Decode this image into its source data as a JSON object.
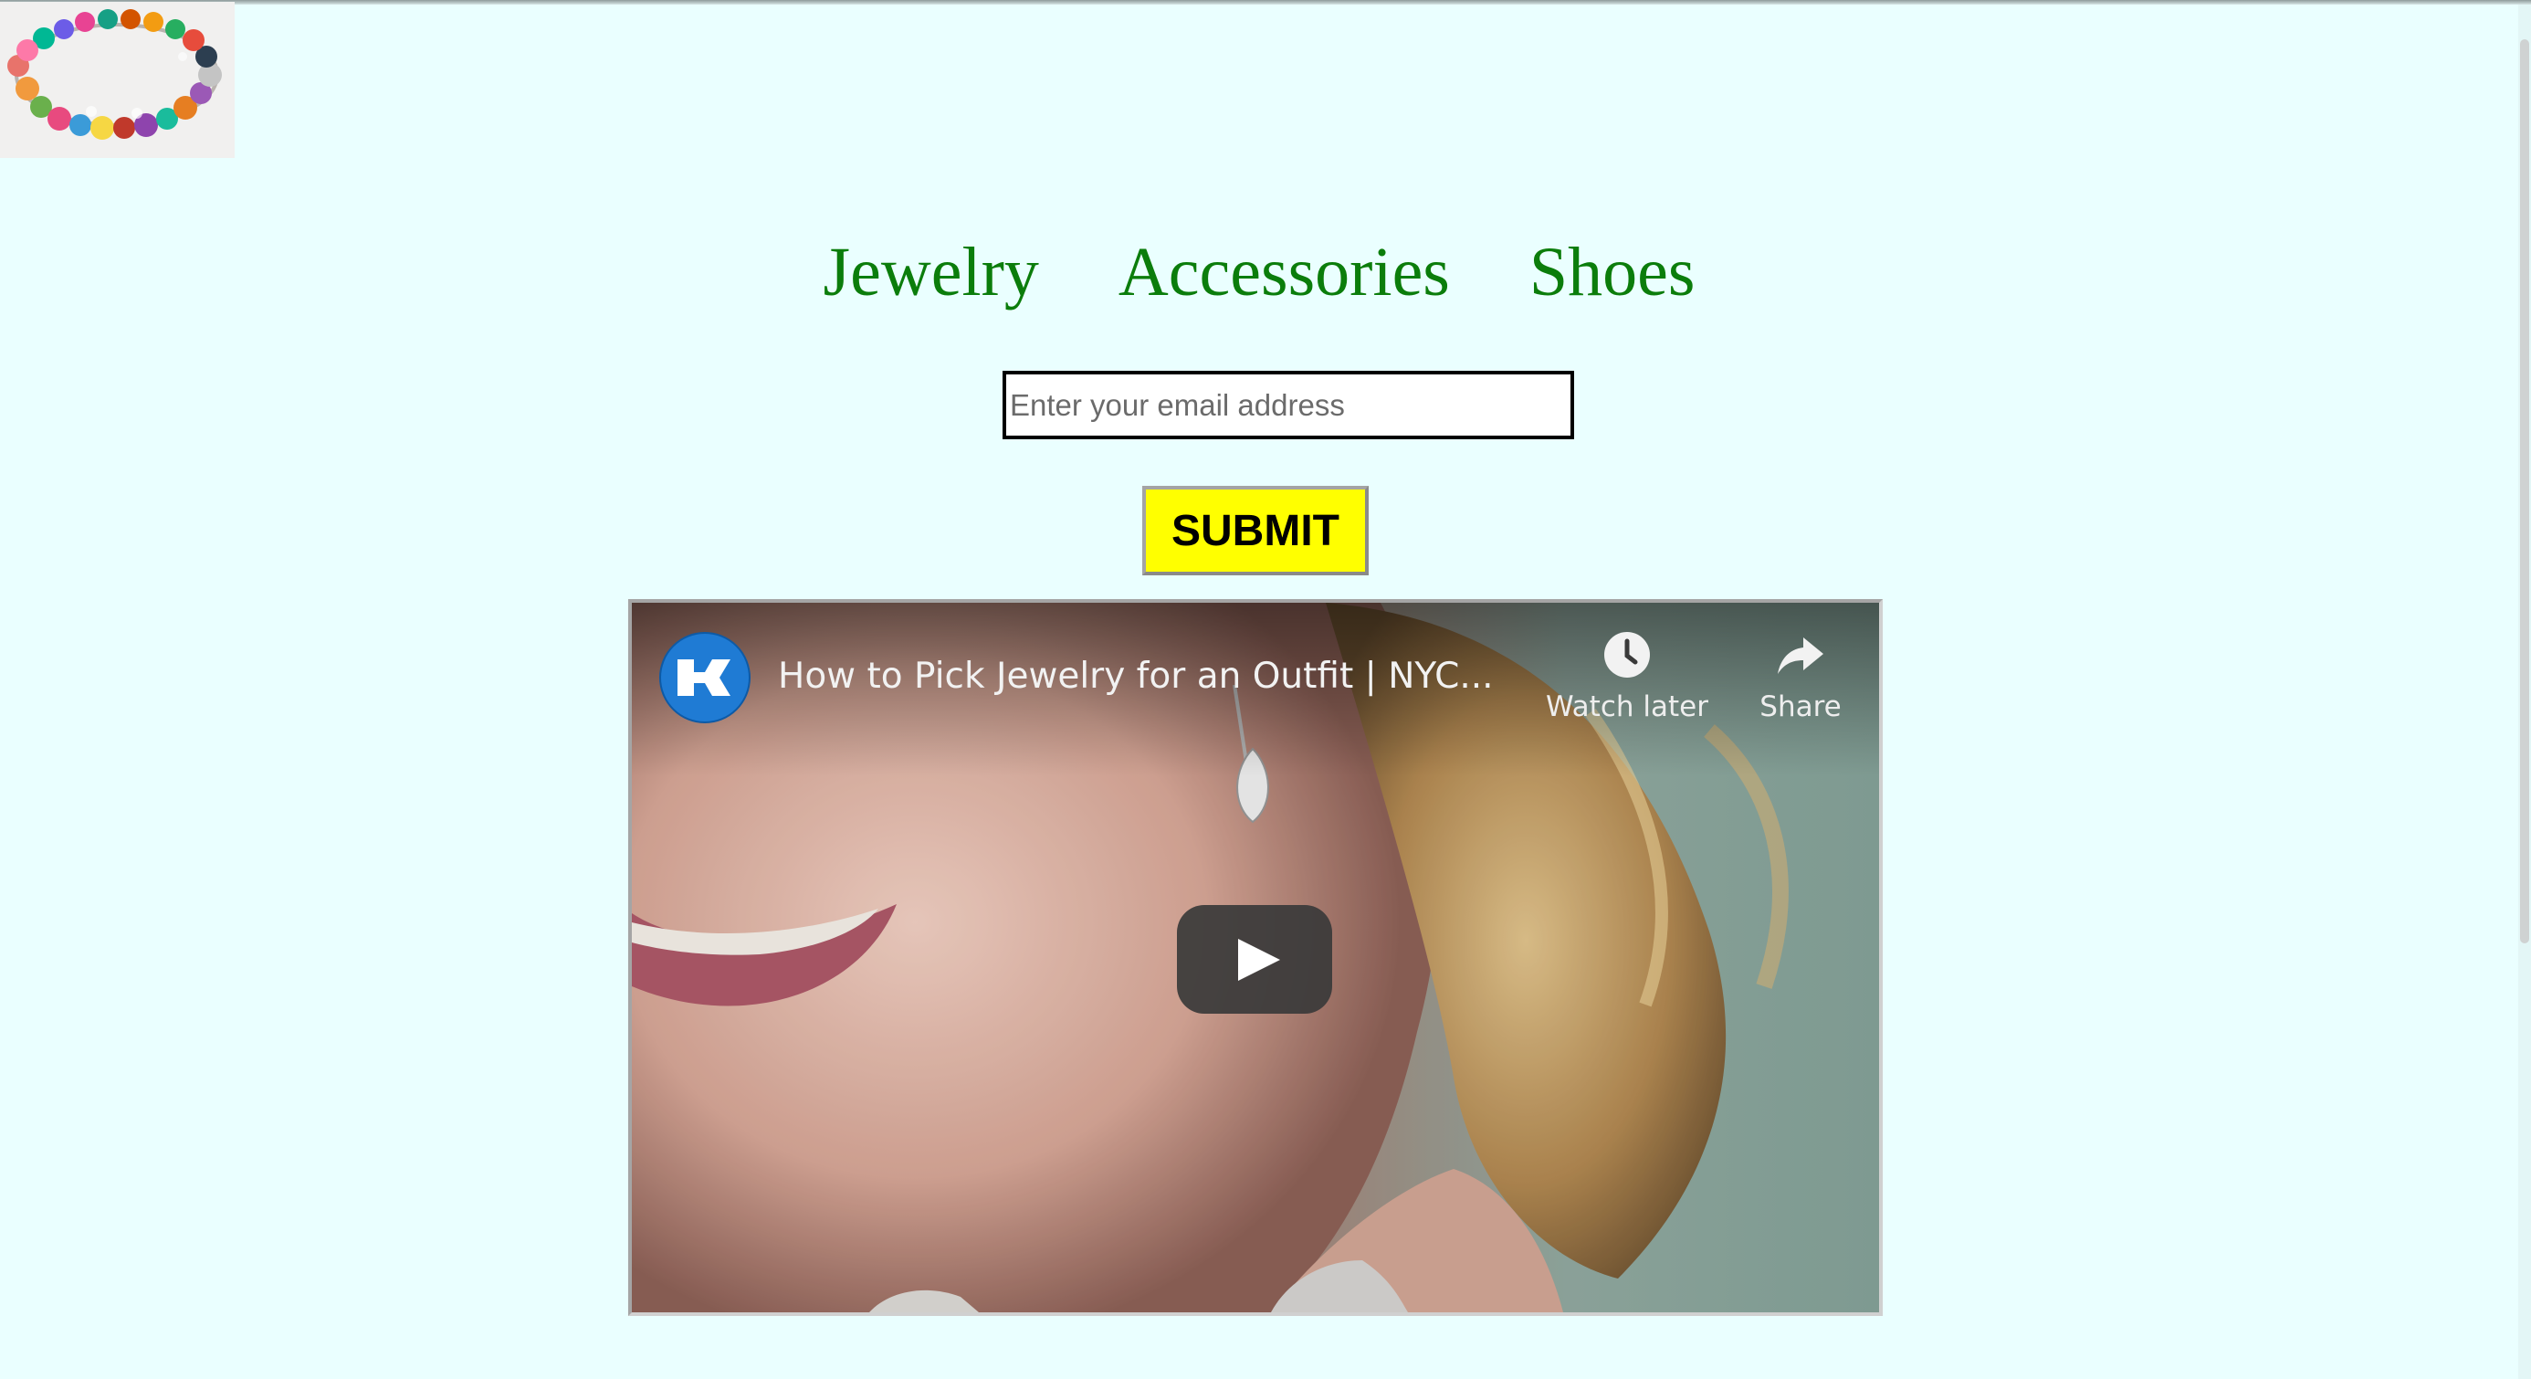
{
  "logo": {
    "alt": "Beaded bracelet",
    "icon": "bracelet-image"
  },
  "nav": {
    "items": [
      {
        "label": "Jewelry"
      },
      {
        "label": "Accessories"
      },
      {
        "label": "Shoes"
      }
    ]
  },
  "signup": {
    "email_placeholder": "Enter your email address",
    "email_value": "",
    "submit_label": "SUBMIT"
  },
  "video": {
    "title": "How to Pick Jewelry for an Outfit | NYC...",
    "watch_later_label": "Watch later",
    "share_label": "Share",
    "channel_icon": "channel-logo-icon",
    "play_icon": "play-icon"
  },
  "colors": {
    "background": "#eaffff",
    "nav_link": "#0b7d0b",
    "submit_bg": "#ffff00",
    "play_button": "#3a3939"
  }
}
